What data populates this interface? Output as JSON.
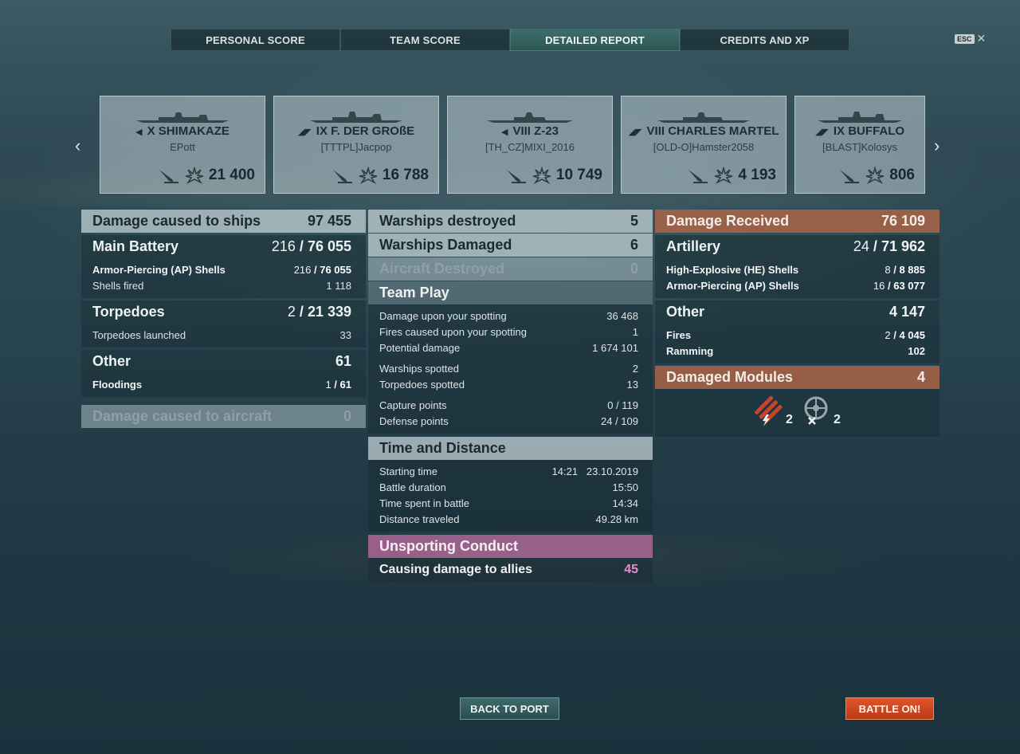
{
  "tabs": [
    {
      "label": "PERSONAL SCORE"
    },
    {
      "label": "TEAM SCORE"
    },
    {
      "label": "DETAILED REPORT"
    },
    {
      "label": "CREDITS AND XP"
    }
  ],
  "esc": {
    "key": "ESC",
    "close": "✕"
  },
  "nav": {
    "prev": "‹",
    "next": "›"
  },
  "cards": [
    {
      "ship": "X SHIMAKAZE",
      "player": "EPott",
      "damage": "21 400"
    },
    {
      "ship": "IX F. DER GROßE",
      "player": "[TTTPL]Jacpop",
      "damage": "16 788"
    },
    {
      "ship": "VIII Z-23",
      "player": "[TH_CZ]MIXI_2016",
      "damage": "10 749"
    },
    {
      "ship": "VIII CHARLES MARTEL",
      "player": "[OLD-O]Hamster2058",
      "damage": "4 193"
    },
    {
      "ship": "IX BUFFALO",
      "player": "[BLAST]Kolosys",
      "damage": "806"
    }
  ],
  "left": {
    "damage_ships": {
      "label": "Damage caused to ships",
      "value": "97 455"
    },
    "main_battery": {
      "label": "Main Battery",
      "hits": "216",
      "value": "76 055"
    },
    "ap_shells": {
      "label": "Armor-Piercing (AP) Shells",
      "hits": "216",
      "value": "76 055"
    },
    "shells_fired": {
      "label": "Shells fired",
      "value": "1 118"
    },
    "torpedoes": {
      "label": "Torpedoes",
      "hits": "2",
      "value": "21 339"
    },
    "torp_launched": {
      "label": "Torpedoes launched",
      "value": "33"
    },
    "other": {
      "label": "Other",
      "value": "61"
    },
    "floodings": {
      "label": "Floodings",
      "hits": "1",
      "value": "61"
    },
    "damage_aircraft": {
      "label": "Damage caused to aircraft",
      "value": "0"
    }
  },
  "middle": {
    "warships_destroyed": {
      "label": "Warships destroyed",
      "value": "5"
    },
    "warships_damaged": {
      "label": "Warships Damaged",
      "value": "6"
    },
    "aircraft_destroyed": {
      "label": "Aircraft Destroyed",
      "value": "0"
    },
    "team_play": {
      "label": "Team Play"
    },
    "spotting_damage": {
      "label": "Damage upon your spotting",
      "value": "36 468"
    },
    "spotting_fires": {
      "label": "Fires caused upon your spotting",
      "value": "1"
    },
    "potential_damage": {
      "label": "Potential damage",
      "value": "1 674 101"
    },
    "warships_spotted": {
      "label": "Warships spotted",
      "value": "2"
    },
    "torpedoes_spotted": {
      "label": "Torpedoes spotted",
      "value": "13"
    },
    "capture_points": {
      "label": "Capture points",
      "value": "0 / 119"
    },
    "defense_points": {
      "label": "Defense points",
      "value": "24 / 109"
    },
    "time_distance": {
      "label": "Time and Distance"
    },
    "starting_time": {
      "label": "Starting time",
      "value": "14:21   23.10.2019"
    },
    "battle_duration": {
      "label": "Battle duration",
      "value": "15:50"
    },
    "time_spent": {
      "label": "Time spent in battle",
      "value": "14:34"
    },
    "distance": {
      "label": "Distance traveled",
      "value": "49.28 km"
    },
    "unsporting": {
      "label": "Unsporting Conduct"
    },
    "ally_damage": {
      "label": "Causing damage to allies",
      "value": "45"
    }
  },
  "right": {
    "damage_received": {
      "label": "Damage Received",
      "value": "76 109"
    },
    "artillery": {
      "label": "Artillery",
      "hits": "24",
      "value": "71 962"
    },
    "he_shells": {
      "label": "High-Explosive (HE) Shells",
      "hits": "8",
      "value": "8 885"
    },
    "ap_shells": {
      "label": "Armor-Piercing (AP) Shells",
      "hits": "16",
      "value": "63 077"
    },
    "other": {
      "label": "Other",
      "value": "4 147"
    },
    "fires": {
      "label": "Fires",
      "hits": "2",
      "value": "4 045"
    },
    "ramming": {
      "label": "Ramming",
      "value": "102"
    },
    "damaged_modules": {
      "label": "Damaged Modules",
      "value": "4"
    },
    "module_torpedo": {
      "count": "2"
    },
    "module_steering": {
      "count": "2"
    }
  },
  "buttons": {
    "back": "BACK TO PORT",
    "battle": "BATTLE ON!"
  },
  "colors": {
    "accent_tab": "#2b5552",
    "received": "#aa6446",
    "unsporting": "#be6ea0",
    "battle_button": "#d0481f",
    "ally_damage_value": "#e68ccf"
  }
}
